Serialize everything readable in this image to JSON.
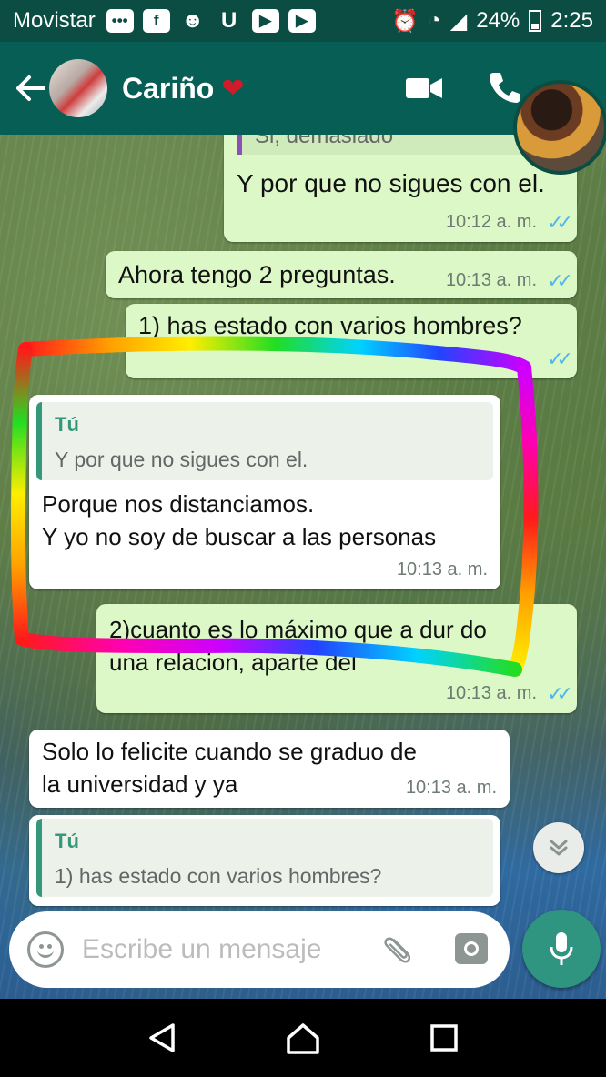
{
  "status_bar": {
    "carrier": "Movistar",
    "battery": "24%",
    "time": "2:25"
  },
  "header": {
    "contact_name": "Cariño"
  },
  "messages": [
    {
      "quote_text": "Si, demasiado",
      "text": "Y por que no sigues con el.",
      "time": "10:12 a. m."
    },
    {
      "text": "Ahora tengo 2 preguntas.",
      "time": "10:13 a. m."
    },
    {
      "text": "1) has estado con varios hombres?",
      "time": ""
    },
    {
      "quote_author": "Tú",
      "quote_text": "Y por que no sigues con el.",
      "text": "Porque nos distanciamos.\nY yo no soy de buscar a las personas",
      "time": "10:13 a. m."
    },
    {
      "text": "2)cuanto es lo máximo que a dur  do\nuna relacion, aparte del",
      "time": "10:13 a. m."
    },
    {
      "text": "Solo lo felicite cuando se graduo de\nla universidad y ya",
      "time": "10:13 a. m."
    },
    {
      "quote_author": "Tú",
      "quote_text": "1) has estado con varios hombres?"
    }
  ],
  "composer": {
    "placeholder": "Escribe un mensaje"
  },
  "icons": {
    "back": "arrow-left-icon",
    "video": "video-camera-icon",
    "call": "phone-icon",
    "emoji": "emoji-icon",
    "attach": "paperclip-icon",
    "camera": "camera-icon",
    "mic": "microphone-icon",
    "scroll_down": "double-chevron-down-icon",
    "nav_back": "triangle-back-icon",
    "nav_home": "home-icon",
    "nav_recents": "square-recents-icon"
  },
  "colors": {
    "app_bar": "#075e54",
    "outgoing_bubble": "#dcf8c6",
    "incoming_bubble": "#ffffff",
    "read_ticks": "#4fb6ec",
    "accent": "#2f9480"
  }
}
